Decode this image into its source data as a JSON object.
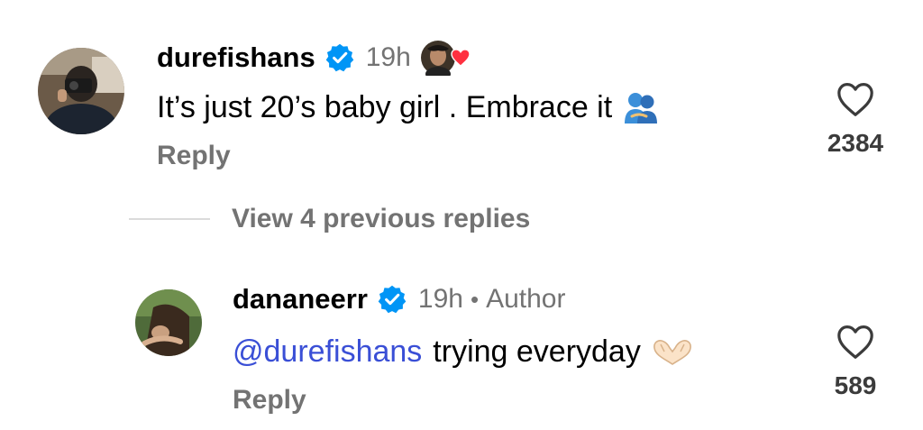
{
  "comments": [
    {
      "username": "durefishans",
      "time": "19h",
      "text": "It’s just 20’s baby girl . Embrace it",
      "reply_label": "Reply",
      "like_count": "2384",
      "emoji": "people-hugging-icon"
    },
    {
      "username": "dananeerr",
      "time": "19h",
      "separator": "•",
      "role": "Author",
      "mention": "@durefishans",
      "text": "trying everyday",
      "reply_label": "Reply",
      "like_count": "589",
      "emoji": "heart-hands-icon"
    }
  ],
  "view_replies_label": "View 4 previous replies",
  "colors": {
    "verified": "#0095f6",
    "mention": "#3a4fd6",
    "secondary_text": "#737373",
    "heart": "#ff3040"
  }
}
